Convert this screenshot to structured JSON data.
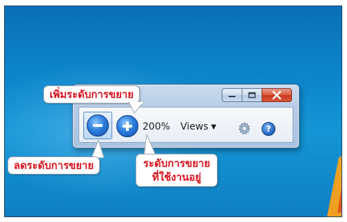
{
  "magnifier": {
    "zoom_level": "200%",
    "views_label": "Views",
    "help_label": "?"
  },
  "callouts": {
    "zoom_in": "เพิ่มระดับการขยาย",
    "zoom_out": "ลดระดับการขยาย",
    "current_zoom_line1": "ระดับการขยาย",
    "current_zoom_line2": "ที่ใช้งานอยู่"
  },
  "colors": {
    "callout_text": "#d8131f",
    "desktop_bg": "#0c83c9",
    "window_frame": "#b7cce6",
    "close_button": "#c63a1f"
  },
  "icons": {
    "zoom_out": "minus-circle-icon",
    "zoom_in": "plus-circle-icon",
    "settings": "gear-icon",
    "help": "help-icon",
    "minimize": "minimize-icon",
    "maximize": "maximize-icon",
    "close": "close-icon"
  }
}
